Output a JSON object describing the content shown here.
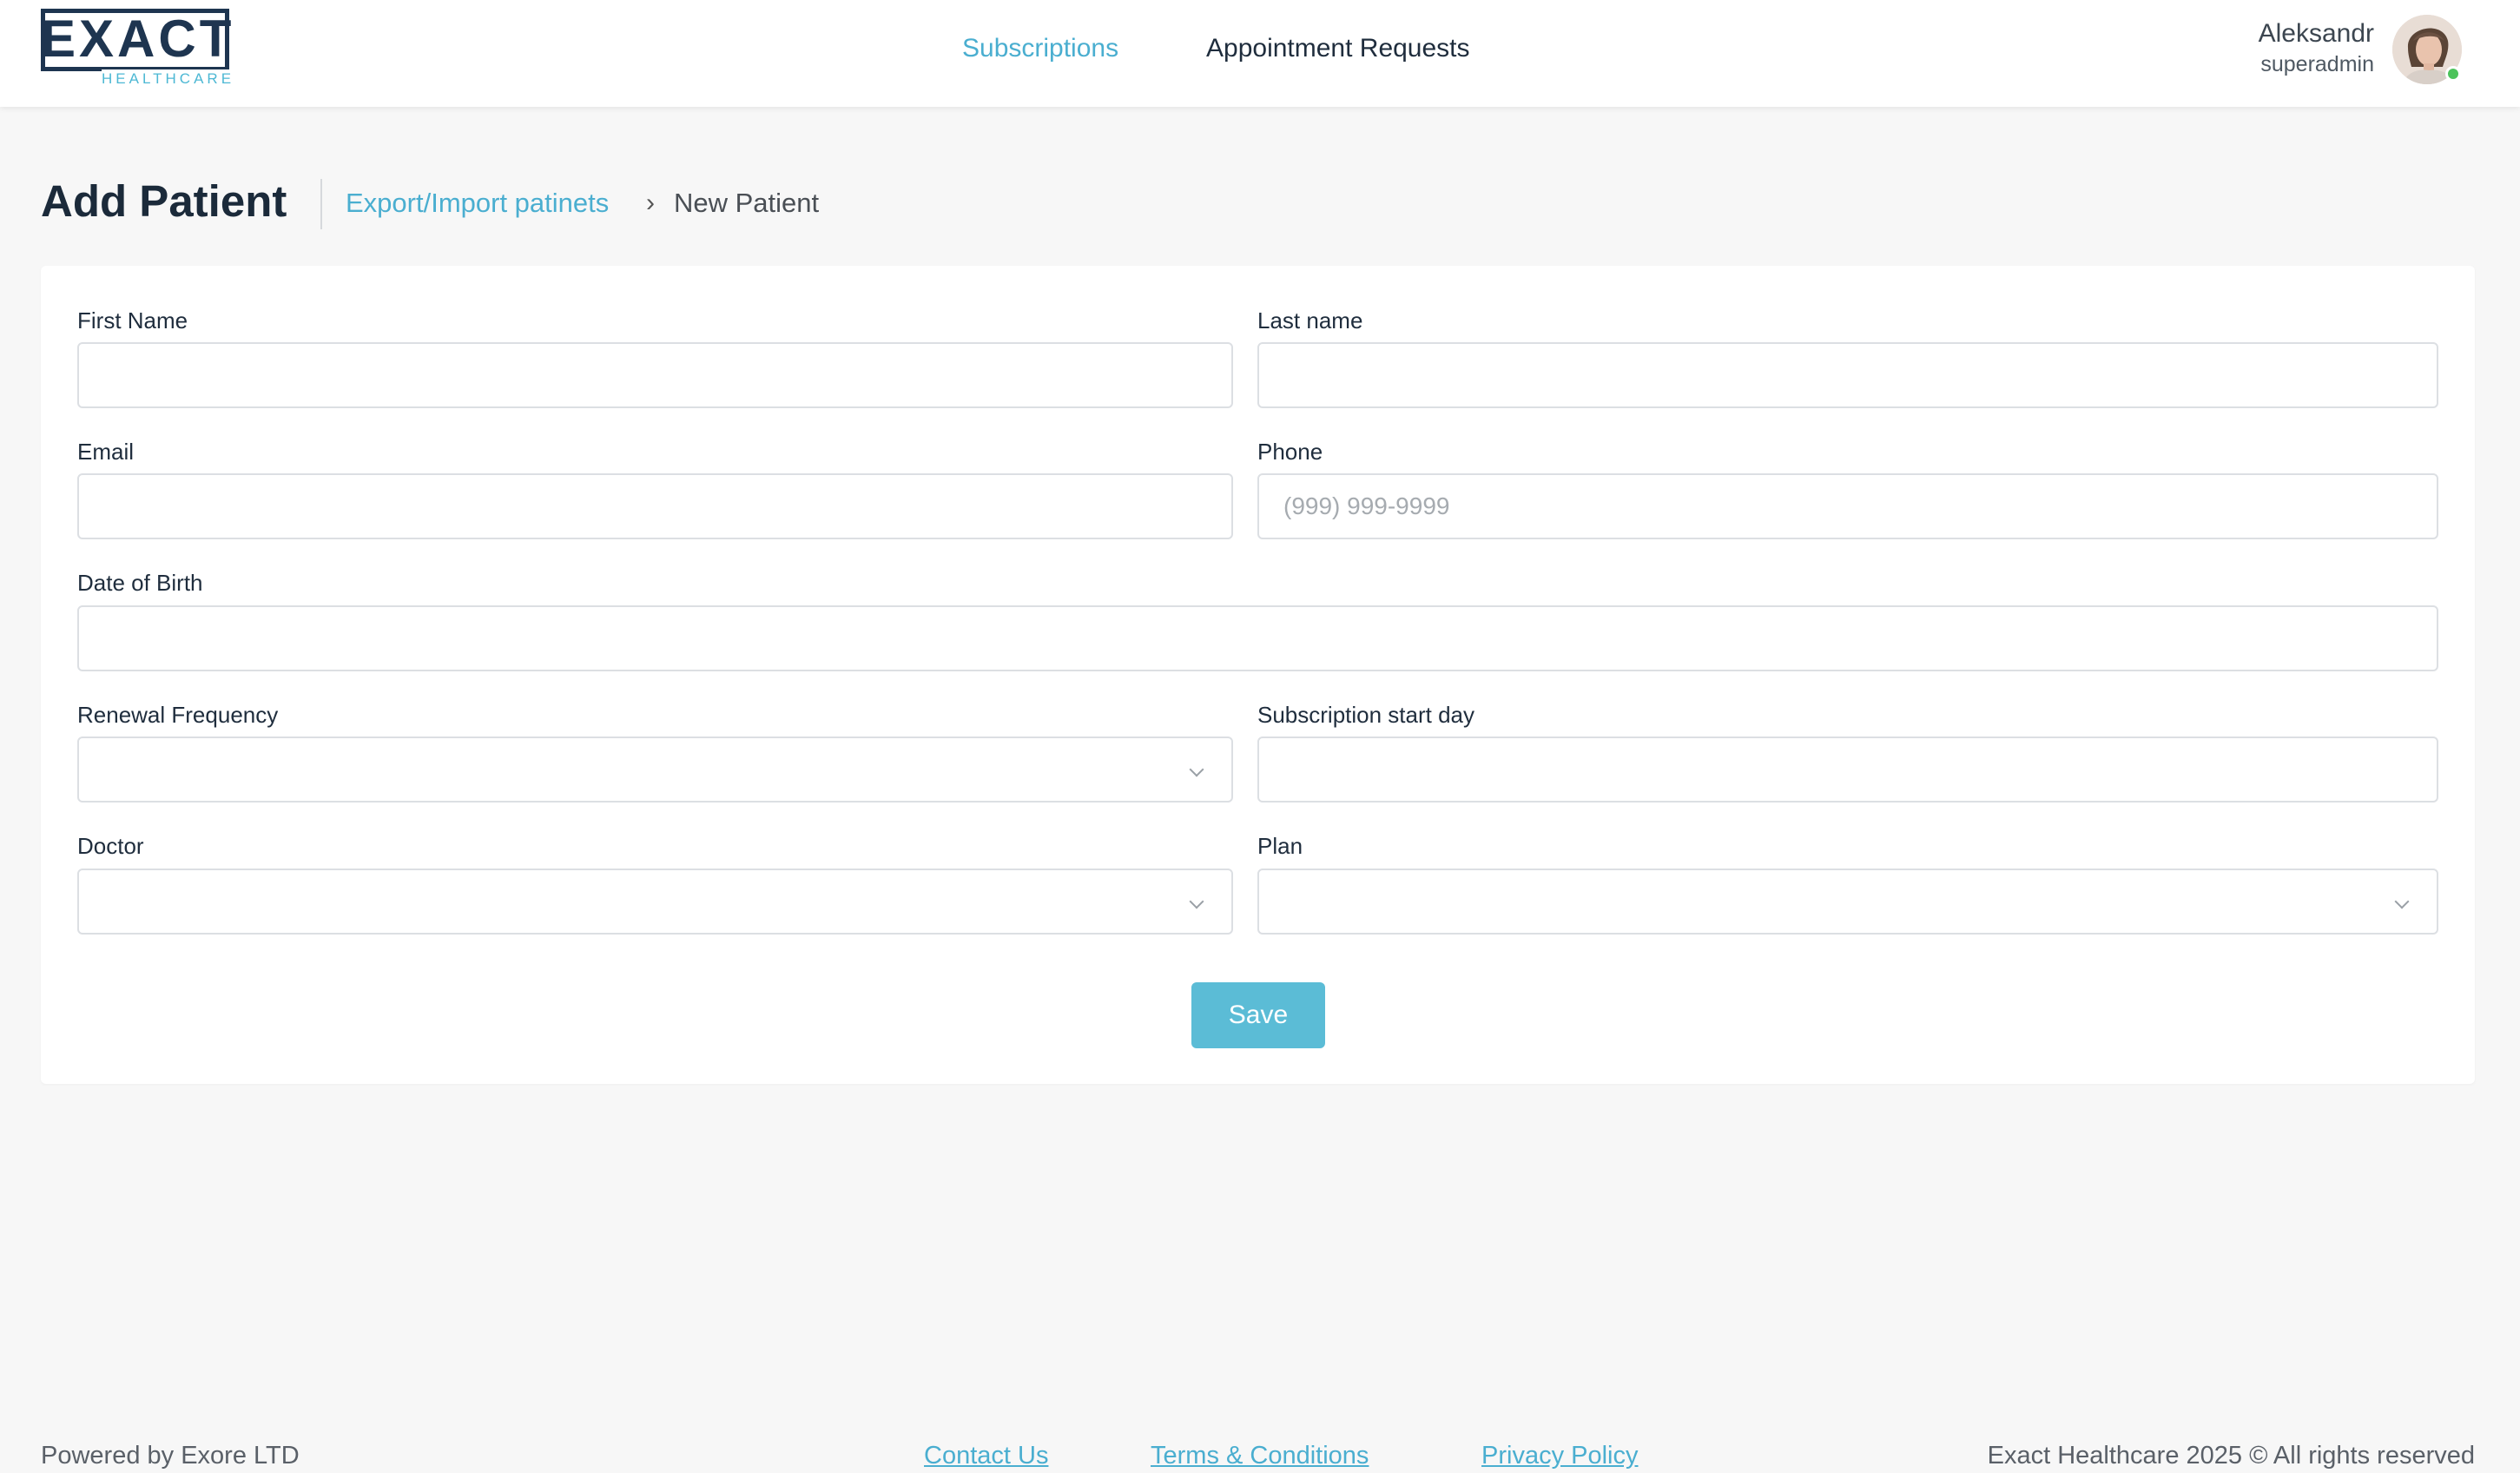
{
  "header": {
    "logo": {
      "word": "EXACT",
      "sub": "HEALTHCARE"
    },
    "nav": [
      {
        "label": "Subscriptions",
        "active": true
      },
      {
        "label": "Appointment Requests",
        "active": false
      }
    ],
    "user": {
      "name": "Aleksandr",
      "role": "superadmin",
      "status": "online"
    }
  },
  "page": {
    "title": "Add Patient",
    "breadcrumb": {
      "link": "Export/Import patinets",
      "separator": "›",
      "current": "New Patient"
    }
  },
  "form": {
    "first_name": {
      "label": "First Name",
      "value": "",
      "placeholder": ""
    },
    "last_name": {
      "label": "Last name",
      "value": "",
      "placeholder": ""
    },
    "email": {
      "label": "Email",
      "value": "",
      "placeholder": ""
    },
    "phone": {
      "label": "Phone",
      "value": "",
      "placeholder": "(999) 999-9999"
    },
    "dob": {
      "label": "Date of Birth",
      "value": "",
      "placeholder": ""
    },
    "renewal": {
      "label": "Renewal Frequency",
      "value": ""
    },
    "sub_start": {
      "label": "Subscription start day",
      "value": "",
      "placeholder": ""
    },
    "doctor": {
      "label": "Doctor",
      "value": ""
    },
    "plan": {
      "label": "Plan",
      "value": ""
    },
    "save_label": "Save"
  },
  "footer": {
    "powered": "Powered by Exore LTD",
    "contact": "Contact Us",
    "terms": "Terms & Conditions",
    "privacy": "Privacy Policy",
    "copyright": "Exact Healthcare 2025 © All rights reserved"
  },
  "colors": {
    "accent": "#4aaed0",
    "button": "#5bbcd6",
    "brand_dark": "#1e3550",
    "status_online": "#4cc35b"
  }
}
